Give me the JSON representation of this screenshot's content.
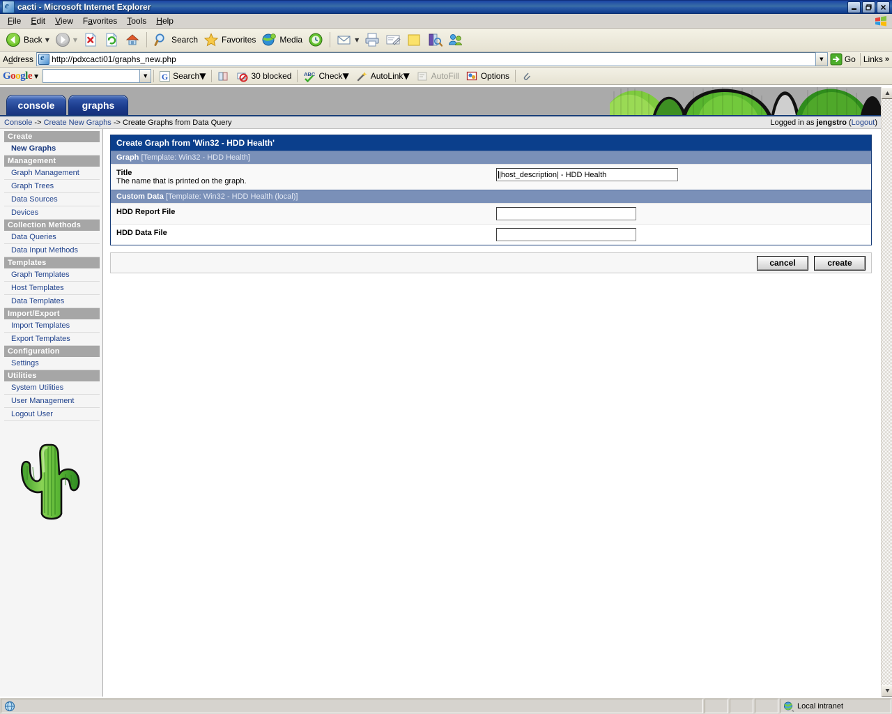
{
  "window": {
    "title": "cacti - Microsoft Internet Explorer",
    "icon": "ie-document-icon",
    "minimize": "_",
    "restore": "❐",
    "close": "✕"
  },
  "menubar": {
    "items": [
      {
        "label": "File",
        "accel": "F"
      },
      {
        "label": "Edit",
        "accel": "E"
      },
      {
        "label": "View",
        "accel": "V"
      },
      {
        "label": "Favorites",
        "accel": "a"
      },
      {
        "label": "Tools",
        "accel": "T"
      },
      {
        "label": "Help",
        "accel": "H"
      }
    ]
  },
  "toolbar": {
    "back_label": "Back",
    "search_label": "Search",
    "favorites_label": "Favorites",
    "media_label": "Media",
    "icons": [
      "back-icon",
      "forward-icon",
      "stop-icon",
      "refresh-icon",
      "home-icon",
      "search-icon",
      "favorites-star-icon",
      "media-icon",
      "history-icon",
      "mail-icon",
      "print-icon",
      "edit-icon",
      "notes-icon",
      "research-icon",
      "messenger-icon"
    ]
  },
  "address": {
    "label": "Address",
    "url": "http://pdxcacti01/graphs_new.php",
    "go_label": "Go",
    "links_label": "Links",
    "links_chevron": "»"
  },
  "google_toolbar": {
    "logo_letters": [
      "G",
      "o",
      "o",
      "g",
      "l",
      "e"
    ],
    "search_value": "",
    "search_label": "Search",
    "blocked_label": "30 blocked",
    "check_label": "Check",
    "autolink_label": "AutoLink",
    "autofill_label": "AutoFill",
    "options_label": "Options"
  },
  "cacti": {
    "tabs": [
      {
        "label": "console",
        "active": true,
        "name": "tab-console"
      },
      {
        "label": "graphs",
        "active": false,
        "name": "tab-graphs"
      }
    ],
    "breadcrumb": {
      "items": [
        "Console",
        "Create New Graphs",
        "Create Graphs from Data Query"
      ],
      "separator": "->"
    },
    "login": {
      "prefix": "Logged in as",
      "user": "jengstro",
      "logout_open": "(",
      "logout": "Logout",
      "logout_close": ")"
    },
    "sidebar": [
      {
        "type": "head",
        "label": "Create"
      },
      {
        "type": "link",
        "label": "New Graphs",
        "current": true
      },
      {
        "type": "head",
        "label": "Management"
      },
      {
        "type": "link",
        "label": "Graph Management"
      },
      {
        "type": "link",
        "label": "Graph Trees"
      },
      {
        "type": "link",
        "label": "Data Sources"
      },
      {
        "type": "link",
        "label": "Devices"
      },
      {
        "type": "head",
        "label": "Collection Methods"
      },
      {
        "type": "link",
        "label": "Data Queries"
      },
      {
        "type": "link",
        "label": "Data Input Methods"
      },
      {
        "type": "head",
        "label": "Templates"
      },
      {
        "type": "link",
        "label": "Graph Templates"
      },
      {
        "type": "link",
        "label": "Host Templates"
      },
      {
        "type": "link",
        "label": "Data Templates"
      },
      {
        "type": "head",
        "label": "Import/Export"
      },
      {
        "type": "link",
        "label": "Import Templates"
      },
      {
        "type": "link",
        "label": "Export Templates"
      },
      {
        "type": "head",
        "label": "Configuration"
      },
      {
        "type": "link",
        "label": "Settings"
      },
      {
        "type": "head",
        "label": "Utilities"
      },
      {
        "type": "link",
        "label": "System Utilities"
      },
      {
        "type": "link",
        "label": "User Management"
      },
      {
        "type": "link",
        "label": "Logout User"
      }
    ],
    "logo_alt": "cacti-cactus-logo"
  },
  "form": {
    "panel_title": "Create Graph from 'Win32 - HDD Health'",
    "sections": [
      {
        "name": "graph-section",
        "head_bold": "Graph",
        "head_tmpl": "[Template: Win32 - HDD Health]",
        "rows": [
          {
            "name": "title-row",
            "label": "Title",
            "desc": "The name that is printed on the graph.",
            "input_name": "title-input",
            "value": "|host_description| - HDD Health",
            "width": "w-title",
            "focused": true
          }
        ]
      },
      {
        "name": "custom-data-section",
        "head_bold": "Custom Data",
        "head_tmpl": "[Template: Win32 - HDD Health (local)]",
        "rows": [
          {
            "name": "hdd-report-file-row",
            "label": "HDD Report File",
            "desc": "",
            "input_name": "hdd-report-file-input",
            "value": "",
            "width": "w-custom",
            "focused": false
          },
          {
            "name": "hdd-data-file-row",
            "label": "HDD Data File",
            "desc": "",
            "input_name": "hdd-data-file-input",
            "value": "",
            "width": "w-custom",
            "focused": false
          }
        ]
      }
    ],
    "buttons": {
      "cancel": "cancel",
      "create": "create"
    }
  },
  "statusbar": {
    "message": "",
    "zone": "Local intranet",
    "zone_icon": "intranet-globe-icon",
    "page_icon": "ie-page-icon"
  },
  "colors": {
    "titlebar_blue": "#0a3d8f",
    "panel_title": "#0b3f8c",
    "section_head": "#7a90b8",
    "nav_head": "#a6a6a6",
    "link_blue": "#22448e",
    "banner_green": "#45a829"
  }
}
